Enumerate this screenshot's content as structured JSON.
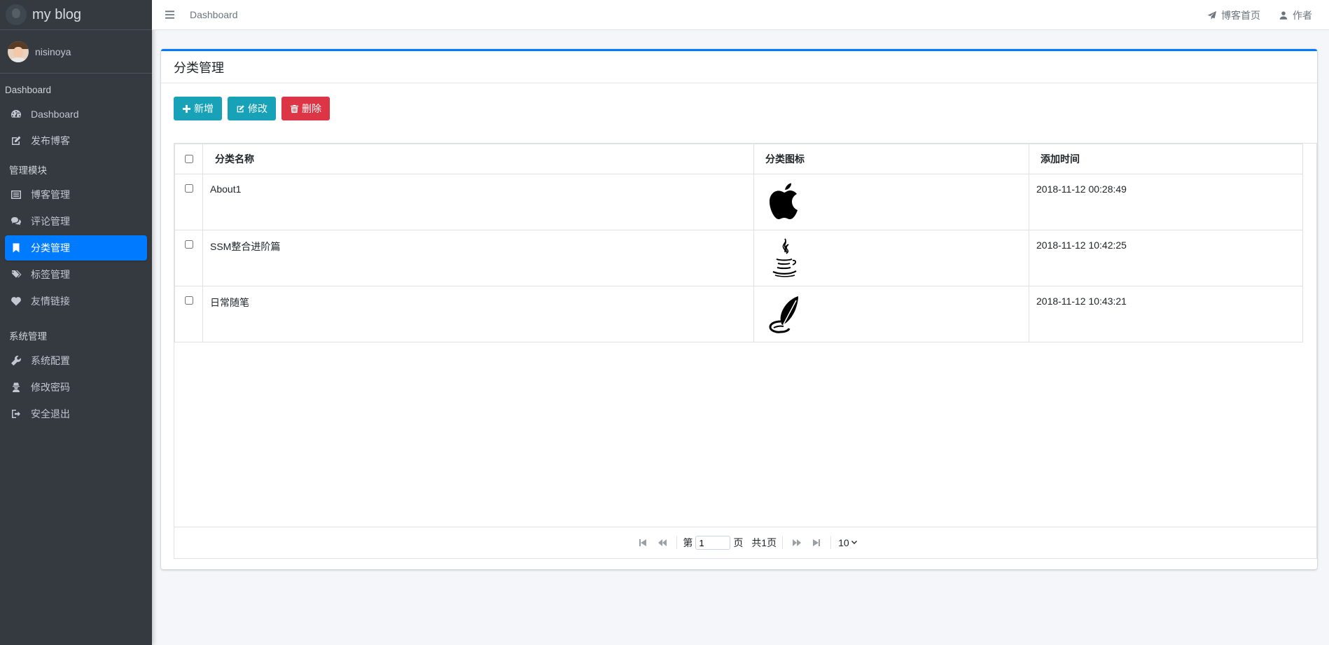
{
  "sidebar": {
    "brand": "my blog",
    "user": "nisinoya",
    "sections": [
      {
        "header": "Dashboard",
        "items": [
          {
            "label": "Dashboard",
            "icon": "dashboard-icon"
          },
          {
            "label": "发布博客",
            "icon": "edit-icon"
          }
        ]
      },
      {
        "header": "管理模块",
        "items": [
          {
            "label": "博客管理",
            "icon": "list-icon"
          },
          {
            "label": "评论管理",
            "icon": "comments-icon"
          },
          {
            "label": "分类管理",
            "icon": "bookmark-icon",
            "active": true
          },
          {
            "label": "标签管理",
            "icon": "tags-icon"
          },
          {
            "label": "友情链接",
            "icon": "heart-icon"
          }
        ]
      },
      {
        "header": "系统管理",
        "items": [
          {
            "label": "系统配置",
            "icon": "wrench-icon"
          },
          {
            "label": "修改密码",
            "icon": "user-secret-icon"
          },
          {
            "label": "安全退出",
            "icon": "sign-out-icon"
          }
        ]
      }
    ]
  },
  "topbar": {
    "crumb": "Dashboard",
    "home_link": "博客首页",
    "author_link": "作者"
  },
  "card": {
    "title": "分类管理",
    "buttons": {
      "add": "新增",
      "edit": "修改",
      "delete": "删除"
    }
  },
  "table": {
    "columns": [
      "分类名称",
      "分类图标",
      "添加时间"
    ],
    "rows": [
      {
        "name": "About1",
        "icon": "apple-icon",
        "time": "2018-11-12 00:28:49"
      },
      {
        "name": "SSM整合进阶篇",
        "icon": "java-icon",
        "time": "2018-11-12 10:42:25"
      },
      {
        "name": "日常随笔",
        "icon": "feather-icon",
        "time": "2018-11-12 10:43:21"
      }
    ]
  },
  "pager": {
    "prefix": "第",
    "page": "1",
    "suffix": "页",
    "total": "共1页",
    "page_size": "10"
  },
  "colors": {
    "accent": "#007bff",
    "info": "#17a2b8",
    "danger": "#dc3545",
    "sidebar_bg": "#343a40"
  }
}
